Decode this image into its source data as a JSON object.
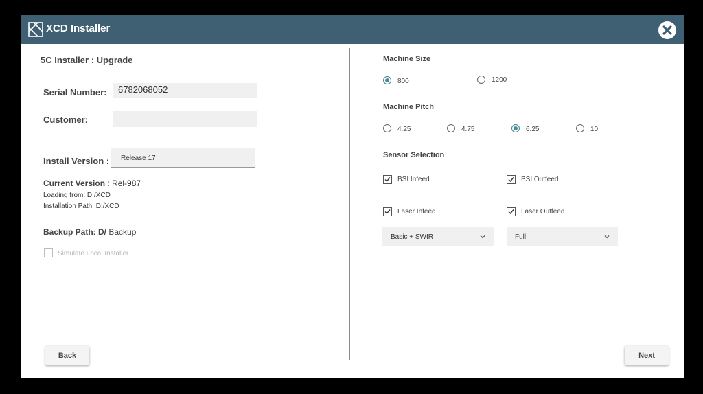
{
  "window": {
    "title": "XCD Installer"
  },
  "left": {
    "heading": "5C Installer : Upgrade",
    "serial_label": "Serial Number:",
    "serial_value": "6782068052",
    "customer_label": "Customer:",
    "customer_value": "",
    "install_version_label": "Install Version :",
    "install_version_value": "Release 17",
    "current_version_label": "Current Version",
    "current_version_value": ": Rel-987",
    "loading_from": "Loading from: D:/XCD",
    "installation_path": "Installation Path:  D:/XCD",
    "backup_path_label": "Backup  Path: D/",
    "backup_path_value": "Backup",
    "simulate_label": "Simulate Local Installer"
  },
  "right": {
    "machine_size_title": "Machine Size",
    "machine_size_options": [
      {
        "label": "800",
        "selected": true
      },
      {
        "label": "1200",
        "selected": false
      }
    ],
    "machine_pitch_title": "Machine Pitch",
    "machine_pitch_options": [
      {
        "label": "4.25",
        "selected": false
      },
      {
        "label": "4.75",
        "selected": false
      },
      {
        "label": "6.25",
        "selected": true
      },
      {
        "label": "10",
        "selected": false
      }
    ],
    "sensor_title": "Sensor Selection",
    "sensors": [
      {
        "label": "BSI Infeed",
        "checked": true
      },
      {
        "label": "BSI Outfeed",
        "checked": true
      },
      {
        "label": "Laser Infeed",
        "checked": true
      },
      {
        "label": "Laser Outfeed",
        "checked": true
      }
    ],
    "laser_infeed_select": "Basic + SWIR",
    "laser_outfeed_select": "Full"
  },
  "footer": {
    "back_label": "Back",
    "next_label": "Next"
  },
  "colors": {
    "titlebar": "#3f5f73",
    "accent": "#3f8f8f"
  },
  "icons": {
    "app_logo": "app-logo-icon",
    "close": "close-icon",
    "dropdown": "chevron-down-icon",
    "check": "check-icon"
  }
}
